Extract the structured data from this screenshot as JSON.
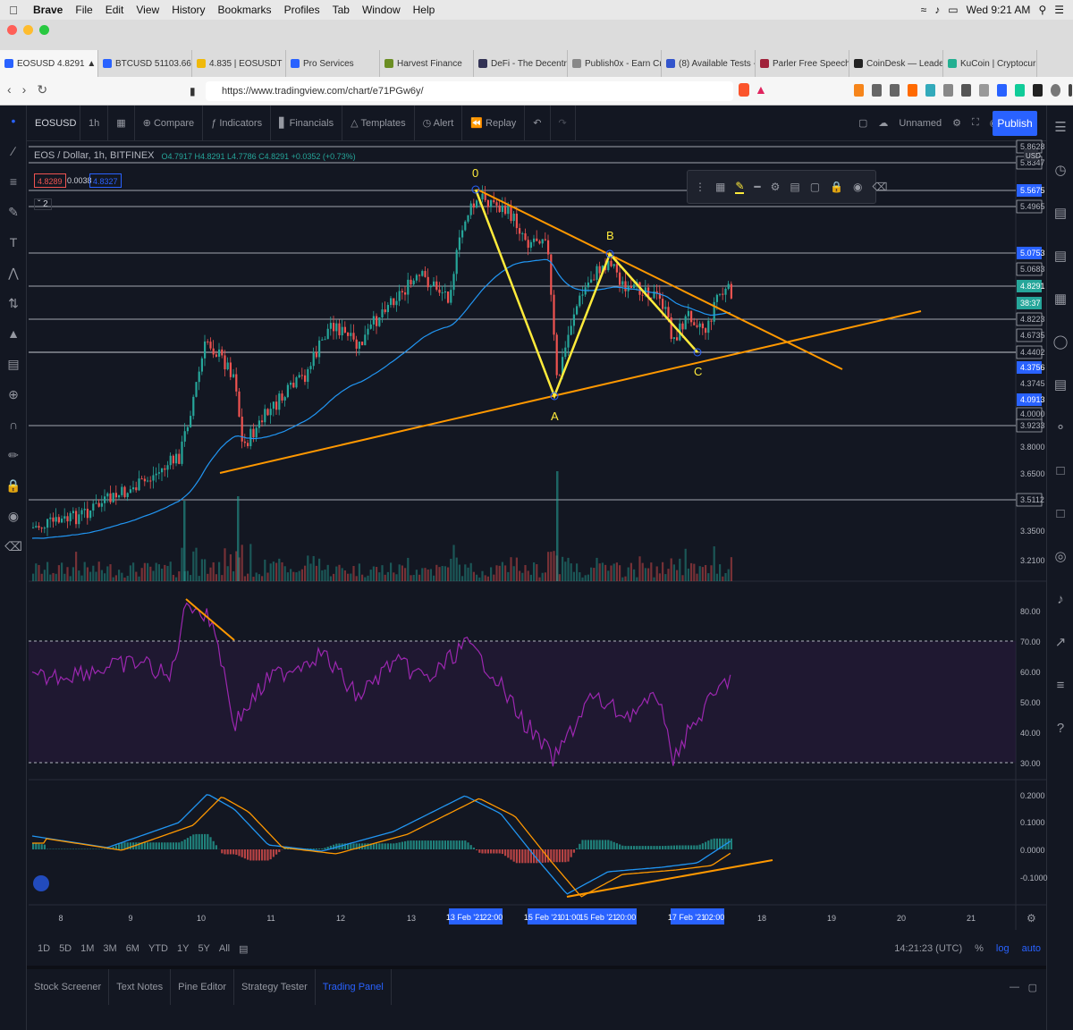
{
  "macos": {
    "app_name": "Brave",
    "menus": [
      "File",
      "Edit",
      "View",
      "History",
      "Bookmarks",
      "Profiles",
      "Tab",
      "Window",
      "Help"
    ],
    "clock": "Wed 9:21 AM"
  },
  "browser": {
    "tabs": [
      {
        "label": "EOSUSD 4.8291 ▲ +",
        "active": true,
        "color": "#2962ff"
      },
      {
        "label": "BTCUSD 51103.66 ▲ +3",
        "active": false,
        "color": "#2962ff"
      },
      {
        "label": "4.835 | EOSUSDT | Binar",
        "active": false,
        "color": "#f0b90b"
      },
      {
        "label": "Pro Services",
        "active": false,
        "color": "#2962ff"
      },
      {
        "label": "Harvest Finance",
        "active": false,
        "color": "#6b8e23"
      },
      {
        "label": "DeFi - The Decentralizec",
        "active": false,
        "color": "#333355"
      },
      {
        "label": "Publish0x - Earn Crypto",
        "active": false,
        "color": "#888888"
      },
      {
        "label": "(8) Available Tests - Use",
        "active": false,
        "color": "#3355cc"
      },
      {
        "label": "Parler Free Speech Socia",
        "active": false,
        "color": "#a0223a"
      },
      {
        "label": "CoinDesk — Leader in cr",
        "active": false,
        "color": "#222222"
      },
      {
        "label": "KuCoin | Cryptocurrency",
        "active": false,
        "color": "#23af91"
      }
    ],
    "url": "https://www.tradingview.com/chart/e71PGw6y/"
  },
  "toolbar": {
    "symbol": "EOSUSD",
    "interval": "1h",
    "compare": "Compare",
    "indicators": "Indicators",
    "financials": "Financials",
    "templates": "Templates",
    "alert": "Alert",
    "replay": "Replay",
    "layout_name": "Unnamed",
    "publish": "Publish"
  },
  "legend": {
    "title": "EOS / Dollar, 1h, BITFINEX",
    "ohlc": "O4.7917 H4.8291 L4.7786 C4.8291 +0.0352 (+0.73%)",
    "bid": "4.8289",
    "spread": "0.0038",
    "ask": "4.8327",
    "collapse_count": "2"
  },
  "price_axis": {
    "currency": "USD",
    "labels": [
      {
        "value": "5.8628",
        "highlight": false
      },
      {
        "value": "5.8347",
        "highlight": false
      },
      {
        "value": "5.5675",
        "highlight": true
      },
      {
        "value": "5.4965",
        "highlight": false
      },
      {
        "value": "5.0753",
        "highlight": true
      },
      {
        "value": "5.0683",
        "highlight": false
      },
      {
        "value": "4.8291",
        "highlight": true,
        "green": true
      },
      {
        "value": "38:37",
        "highlight": true,
        "green": true
      },
      {
        "value": "4.8223",
        "highlight": false
      },
      {
        "value": "4.6735",
        "highlight": false
      },
      {
        "value": "4.4402",
        "highlight": false
      },
      {
        "value": "4.3756",
        "highlight": true
      },
      {
        "value": "4.3745",
        "highlight": false
      },
      {
        "value": "4.0913",
        "highlight": true
      },
      {
        "value": "4.0000",
        "highlight": false
      },
      {
        "value": "3.9233",
        "highlight": false
      },
      {
        "value": "3.8000",
        "highlight": false
      },
      {
        "value": "3.6500",
        "highlight": false
      },
      {
        "value": "3.5112",
        "highlight": false
      },
      {
        "value": "3.3500",
        "highlight": false
      },
      {
        "value": "3.2100",
        "highlight": false
      }
    ]
  },
  "annotations": {
    "points": [
      "0",
      "A",
      "B",
      "C"
    ]
  },
  "rsi_axis": [
    "80.00",
    "70.00",
    "60.00",
    "50.00",
    "40.00",
    "30.00"
  ],
  "macd_axis": [
    "0.2000",
    "0.1000",
    "0.0000",
    "-0.1000"
  ],
  "time_axis": {
    "ticks": [
      "8",
      "9",
      "10",
      "11",
      "12",
      "13",
      "18",
      "19",
      "20",
      "21"
    ],
    "highlight": [
      "13 Feb '21",
      "22:00",
      "15 Feb '21",
      "01:00",
      "15 Feb '21",
      "20:00",
      "17 Feb '21",
      "02:00"
    ]
  },
  "bottom": {
    "ranges": [
      "1D",
      "5D",
      "1M",
      "3M",
      "6M",
      "YTD",
      "1Y",
      "5Y",
      "All"
    ],
    "utc_time": "14:21:23 (UTC)",
    "pct": "%",
    "log": "log",
    "auto": "auto"
  },
  "panel_tabs": [
    "Stock Screener",
    "Text Notes",
    "Pine Editor",
    "Strategy Tester",
    "Trading Panel"
  ],
  "colors": {
    "up": "#26a69a",
    "down": "#ef5350",
    "accent": "#2962ff",
    "yellow": "#ffeb3b",
    "orange": "#ff9800",
    "rsi": "#9c27b0",
    "ema": "#2196f3"
  }
}
